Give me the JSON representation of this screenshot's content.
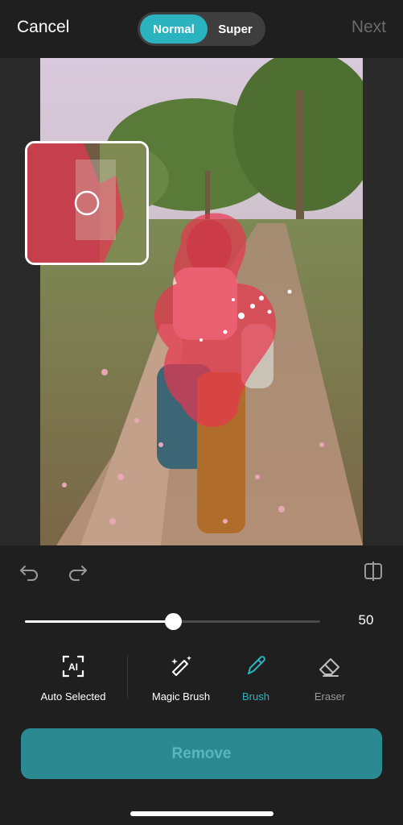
{
  "header": {
    "cancel_label": "Cancel",
    "next_label": "Next",
    "modes": {
      "normal": "Normal",
      "super": "Super",
      "selected": "Normal"
    }
  },
  "icons": {
    "undo": "undo-icon",
    "redo": "redo-icon",
    "compare": "compare-icon",
    "auto_selected": "ai-select-icon",
    "magic_brush": "magic-wand-icon",
    "brush": "brush-icon",
    "eraser": "eraser-icon"
  },
  "brush_size": {
    "value": "50",
    "fraction": 0.5
  },
  "tools": {
    "auto_selected": "Auto Selected",
    "magic_brush": "Magic Brush",
    "brush": "Brush",
    "eraser": "Eraser",
    "active": "Brush"
  },
  "remove_label": "Remove",
  "colors": {
    "accent": "#2bb3c0",
    "remove_button": "#2b8a91",
    "selection_overlay": "#e8344f",
    "background": "#1f1f1f"
  }
}
